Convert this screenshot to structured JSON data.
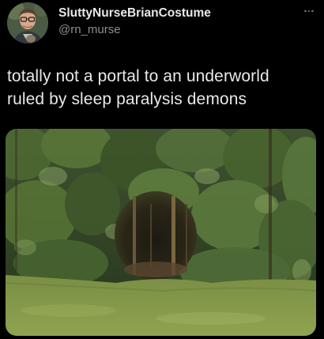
{
  "tweet": {
    "display_name": "SluttyNurseBrianCostume",
    "handle": "@rn_murse",
    "text_lines": [
      "totally not a portal to an underworld",
      "ruled by sleep paralysis demons"
    ],
    "more_icon": "more-horizontal-icon",
    "media_description_icon": "photo"
  },
  "colors": {
    "background": "#000000",
    "primary_text": "#e7e9ea",
    "secondary_text": "#8b8f93"
  }
}
